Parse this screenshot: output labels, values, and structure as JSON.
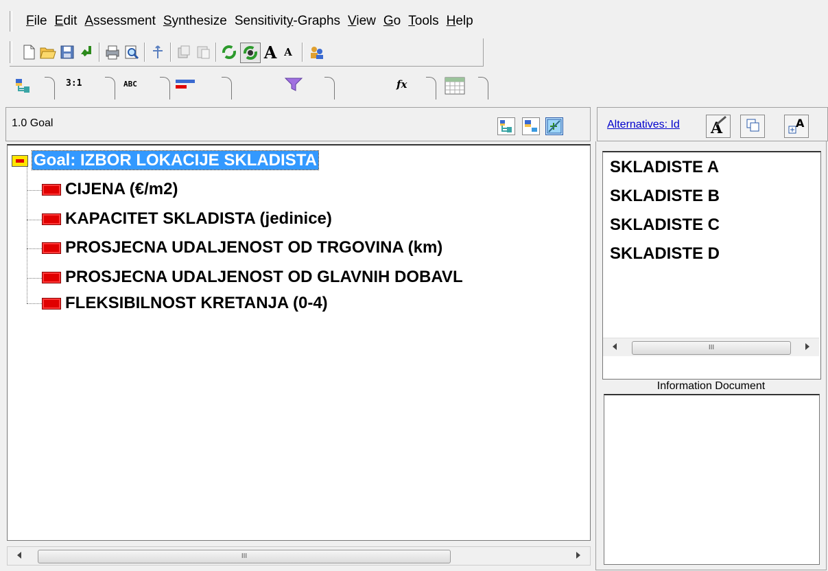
{
  "menubar": {
    "items": [
      {
        "pre": "",
        "ul": "F",
        "post": "ile"
      },
      {
        "pre": "",
        "ul": "E",
        "post": "dit"
      },
      {
        "pre": "",
        "ul": "A",
        "post": "ssessment"
      },
      {
        "pre": "",
        "ul": "S",
        "post": "ynthesize"
      },
      {
        "pre": "Sensitivit",
        "ul": "y",
        "post": "-Graphs"
      },
      {
        "pre": "",
        "ul": "V",
        "post": "iew"
      },
      {
        "pre": "",
        "ul": "G",
        "post": "o"
      },
      {
        "pre": "",
        "ul": "T",
        "post": "ools"
      },
      {
        "pre": "",
        "ul": "H",
        "post": "elp"
      }
    ]
  },
  "tabs": {
    "ratio_label": "3:1",
    "abc_label": "ABC",
    "fx_label": "fx"
  },
  "left_panel": {
    "node_label": "1.0 Goal",
    "goal": "Goal: IZBOR LOKACIJE SKLADISTA",
    "criteria": [
      "CIJENA (€/m2)",
      "KAPACITET SKLADISTA (jedinice)",
      "PROSJECNA UDALJENOST OD TRGOVINA (km)",
      "PROSJECNA UDALJENOST OD GLAVNIH DOBAVL"
    ],
    "last_criterion": "FLEKSIBILNOST KRETANJA (0-4)",
    "scroll_grip": "III"
  },
  "right_panel": {
    "alternatives_link": "Alternatives: Id",
    "alternatives": [
      "SKLADISTE A",
      "SKLADISTE B",
      "SKLADISTE C",
      "SKLADISTE D"
    ],
    "scroll_grip": "III",
    "info_label": "Information Document"
  },
  "colors": {
    "goal_highlight": "#3399ff",
    "criterion_box": "#e00000",
    "goal_box": "#ffe600",
    "link": "#0000cc"
  }
}
